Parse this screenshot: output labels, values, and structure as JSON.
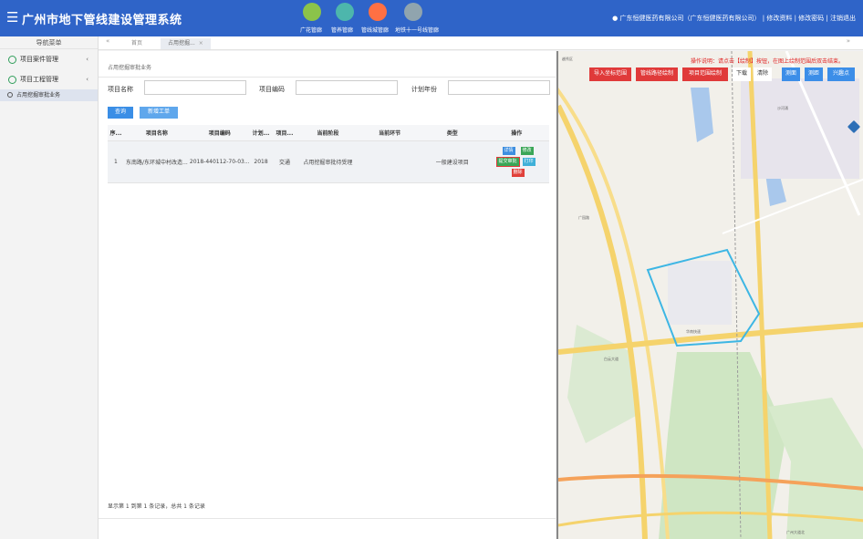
{
  "header": {
    "title": "广州市地下管线建设管理系统",
    "menu_icon": "hamburger-icon",
    "nav": [
      {
        "label": "广花管廊",
        "icon": "train-icon",
        "color": "#8bc34a"
      },
      {
        "label": "管养管廊",
        "icon": "tunnel-icon",
        "color": "#4db6ac"
      },
      {
        "label": "管线城管廊",
        "icon": "bird-icon",
        "color": "#ff7043"
      },
      {
        "label": "地铁十一号线管廊",
        "icon": "metro-icon",
        "color": "#90a4ae"
      }
    ],
    "user": "广东恒健医药有限公司（广东恒健医药有限公司）",
    "edit_profile": "修改资料",
    "change_password": "修改密码",
    "logout": "注销退出"
  },
  "sidebar": {
    "title": "导航菜单",
    "items": [
      {
        "label": "项目案件管理",
        "icon": "globe-icon"
      },
      {
        "label": "项目工程管理",
        "icon": "globe-icon"
      }
    ],
    "sub_items": [
      {
        "label": "占用挖掘审批业务"
      }
    ]
  },
  "tabs": {
    "home": "首页",
    "active": "占用挖掘...",
    "close": "×",
    "prev": "«",
    "next": "»"
  },
  "main": {
    "breadcrumb": "占用挖掘审批业务",
    "filters": {
      "project_name_label": "项目名称",
      "project_code_label": "项目编码",
      "plan_year_label": "计划年份",
      "project_name_value": "",
      "project_code_value": "",
      "plan_year_value": ""
    },
    "buttons": {
      "query": "查询",
      "new_project": "新增工单"
    },
    "table": {
      "headers": [
        "序...",
        "项目名称",
        "项目编码",
        "计划...",
        "项目...",
        "当前阶段",
        "当前环节",
        "类型",
        "操作"
      ],
      "rows": [
        {
          "index": "1",
          "name": "东南路/东环城中村改造...",
          "code": "2018-440112-70-03...",
          "year": "2018",
          "category": "交通",
          "stage": "占用挖掘审批待受理",
          "step": "",
          "type": "一般建设项目",
          "ops": {
            "view": "详情",
            "edit": "修改",
            "submit": "提交审批",
            "print": "打印",
            "delete": "删除"
          }
        }
      ]
    },
    "pager": "显示第 1 到第 1 条记录，总共 1 条记录"
  },
  "map": {
    "tip": "操作说明：请点击【绘制】按钮，在图上绘制范围后双击结束。",
    "buttons": {
      "import_shp": "导入坐标范围",
      "draw_line": "管线路径绘制",
      "draw_area": "项目范围绘制",
      "download": "下载",
      "clear": "清除",
      "measure_area": "测面",
      "measure_len": "测距",
      "draw_point": "兴趣点"
    },
    "labels": [
      "越秀区",
      "广园路",
      "华南快速",
      "白云大道",
      "沙河涌",
      "广州大道北"
    ],
    "layers_icon": "layers-icon",
    "colors": {
      "boundary": "#3db6e4",
      "road": "#f5d36c",
      "green": "#cfe6c3",
      "water": "#a9c8ec"
    }
  }
}
